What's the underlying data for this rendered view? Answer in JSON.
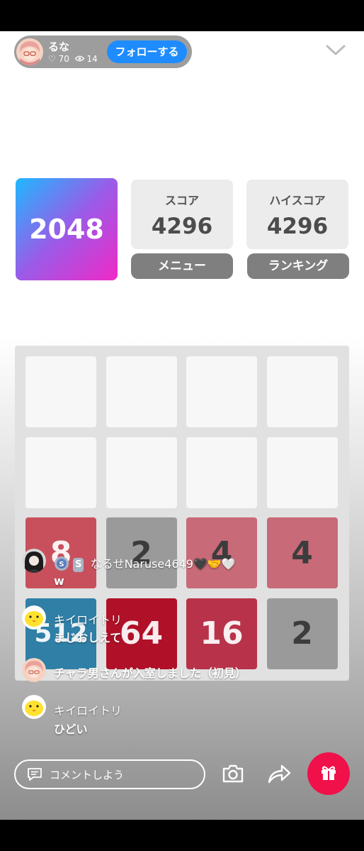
{
  "streamer": {
    "name": "るな",
    "likes": "♡ 70",
    "views": "14",
    "follow_label": "フォローする"
  },
  "game": {
    "logo": "2048",
    "score_label": "スコア",
    "score": "4296",
    "high_label": "ハイスコア",
    "high": "4296",
    "menu_label": "メニュー",
    "ranking_label": "ランキング"
  },
  "board": {
    "rows": [
      [
        "",
        "",
        "",
        ""
      ],
      [
        "",
        "",
        "",
        ""
      ],
      [
        "8",
        "2",
        "4",
        "4"
      ],
      [
        "512",
        "64",
        "16",
        "2"
      ]
    ],
    "colors": {
      "empty": "#f7f7f7",
      "2": "#9a9a9a",
      "4": "#c86a78",
      "8": "#c8505d",
      "16": "#b8334a",
      "64": "#b01028",
      "512": "#2f7fa6"
    }
  },
  "comments": [
    {
      "user": "なるせNaruse4649🖤🤝🤍",
      "badge": "S",
      "text": "w"
    },
    {
      "user": "キイロイトリ",
      "text": "まじおしえて"
    },
    {
      "user": "",
      "text": "チャラ男さんが入室しました（初見）"
    },
    {
      "user": "キイロイトリ",
      "text": "ひどい"
    }
  ],
  "bottom": {
    "comment_placeholder": "コメントしよう"
  },
  "icons": [
    "heart-icon",
    "eye-icon",
    "chevron-down-icon",
    "comment-icon",
    "camera-icon",
    "share-icon",
    "gift-icon"
  ]
}
